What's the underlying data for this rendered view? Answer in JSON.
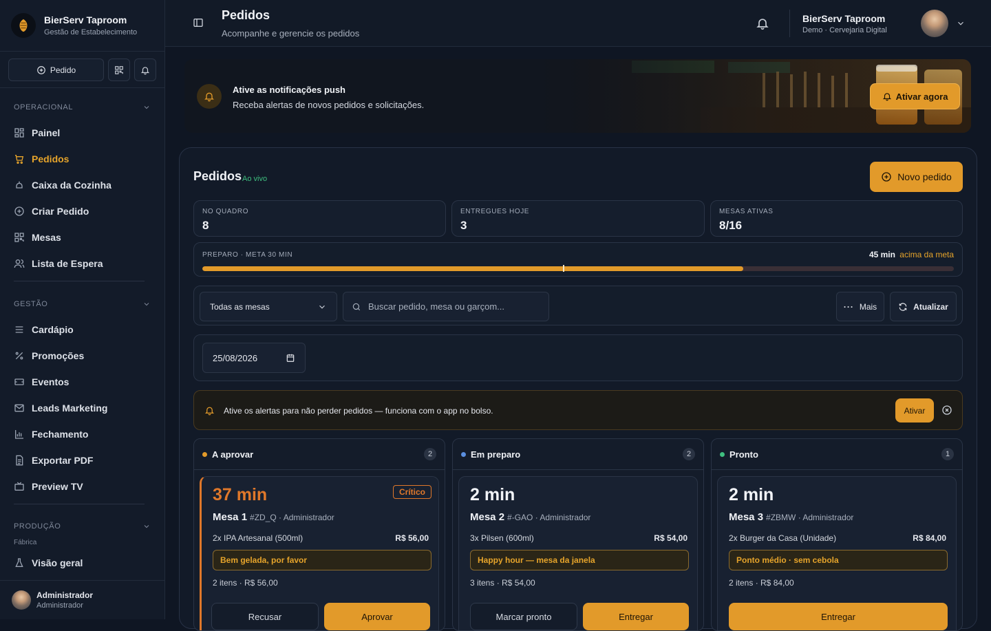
{
  "sidebar": {
    "brand_name": "BierServ Taproom",
    "brand_sub": "Gestão de Estabelecimento",
    "quick_order_label": "Pedido",
    "sections": [
      {
        "title": "OPERACIONAL",
        "items": [
          {
            "label": "Painel",
            "icon": "dashboard-icon"
          },
          {
            "label": "Pedidos",
            "icon": "cart-icon",
            "active": true
          },
          {
            "label": "Caixa da Cozinha",
            "icon": "kitchen-icon"
          },
          {
            "label": "Criar Pedido",
            "icon": "plus-circle-icon"
          },
          {
            "label": "Mesas",
            "icon": "qr-icon"
          },
          {
            "label": "Lista de Espera",
            "icon": "users-icon"
          }
        ]
      },
      {
        "title": "GESTÃO",
        "items": [
          {
            "label": "Cardápio",
            "icon": "menu-icon"
          },
          {
            "label": "Promoções",
            "icon": "percent-icon"
          },
          {
            "label": "Eventos",
            "icon": "ticket-icon"
          },
          {
            "label": "Leads Marketing",
            "icon": "mail-icon"
          },
          {
            "label": "Fechamento",
            "icon": "bar-chart-icon"
          },
          {
            "label": "Exportar PDF",
            "icon": "file-icon"
          },
          {
            "label": "Preview TV",
            "icon": "tv-icon"
          }
        ]
      },
      {
        "title": "PRODUÇÃO",
        "subtitle": "Fábrica",
        "items": [
          {
            "label": "Visão geral",
            "icon": "flask-icon"
          }
        ]
      }
    ],
    "user_name": "Administrador",
    "user_role": "Administrador"
  },
  "topbar": {
    "title": "Pedidos",
    "subtitle": "Acompanhe e gerencie os pedidos",
    "account_name": "BierServ Taproom",
    "account_sub": "Demo · Cervejaria Digital"
  },
  "push_banner": {
    "title": "Ative as notificações push",
    "text": "Receba alertas de novos pedidos e solicitações.",
    "button": "Ativar agora"
  },
  "orders": {
    "title": "Pedidos",
    "live": "Ao vivo",
    "new_button": "Novo pedido",
    "stats": [
      {
        "label": "NO QUADRO",
        "value": "8"
      },
      {
        "label": "ENTREGUES HOJE",
        "value": "3"
      },
      {
        "label": "MESAS ATIVAS",
        "value": "8/16"
      }
    ],
    "prep": {
      "label": "PREPARO · META 30 MIN",
      "value": "45 min",
      "status": "acima da meta",
      "progress_fraction": 0.72,
      "goal_fraction": 0.48
    },
    "filter_table": "Todas as mesas",
    "search_placeholder": "Buscar pedido, mesa ou garçom...",
    "more_button": "Mais",
    "refresh_button": "Atualizar",
    "date": "25/08/2026",
    "alert_text": "Ative os alertas para não perder pedidos — funciona com o app no bolso.",
    "alert_button": "Ativar",
    "columns": [
      {
        "title": "A aprovar",
        "count": "2",
        "color": "#e29a2a",
        "card": {
          "time": "37 min",
          "badge": "Crítico",
          "mesa": "Mesa 1",
          "meta": "#ZD_Q · Administrador",
          "item": "2x IPA Artesanal (500ml)",
          "price": "R$ 56,00",
          "note": "Bem gelada, por favor",
          "summary": "2 itens · R$ 56,00",
          "btn1": "Recusar",
          "btn2": "Aprovar"
        }
      },
      {
        "title": "Em preparo",
        "count": "2",
        "color": "#5b8fe0",
        "card": {
          "time": "2 min",
          "mesa": "Mesa 2",
          "meta": "#-GAO · Administrador",
          "item": "3x Pilsen (600ml)",
          "price": "R$ 54,00",
          "note": "Happy hour — mesa da janela",
          "summary": "3 itens · R$ 54,00",
          "btn1": "Marcar pronto",
          "btn2": "Entregar"
        }
      },
      {
        "title": "Pronto",
        "count": "1",
        "color": "#3fbf7f",
        "card": {
          "time": "2 min",
          "mesa": "Mesa 3",
          "meta": "#ZBMW · Administrador",
          "item": "2x Burger da Casa (Unidade)",
          "price": "R$ 84,00",
          "note": "Ponto médio · sem cebola",
          "summary": "2 itens · R$ 84,00",
          "btn2": "Entregar"
        }
      }
    ]
  }
}
